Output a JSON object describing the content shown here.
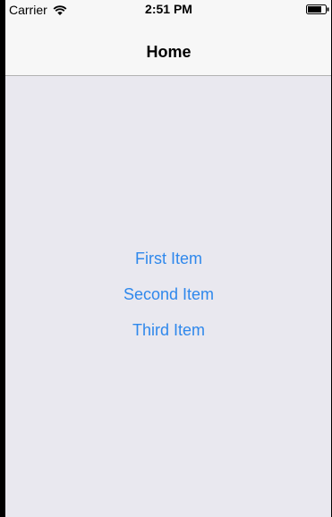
{
  "status_bar": {
    "carrier": "Carrier",
    "time": "2:51 PM",
    "wifi_icon": "wifi-icon",
    "battery_icon": "battery-icon"
  },
  "nav_bar": {
    "title": "Home"
  },
  "items": [
    {
      "label": "First Item"
    },
    {
      "label": "Second Item"
    },
    {
      "label": "Third Item"
    }
  ],
  "colors": {
    "background": "#e9e8ef",
    "bar_background": "#f7f7f7",
    "link": "#2f88ec"
  }
}
